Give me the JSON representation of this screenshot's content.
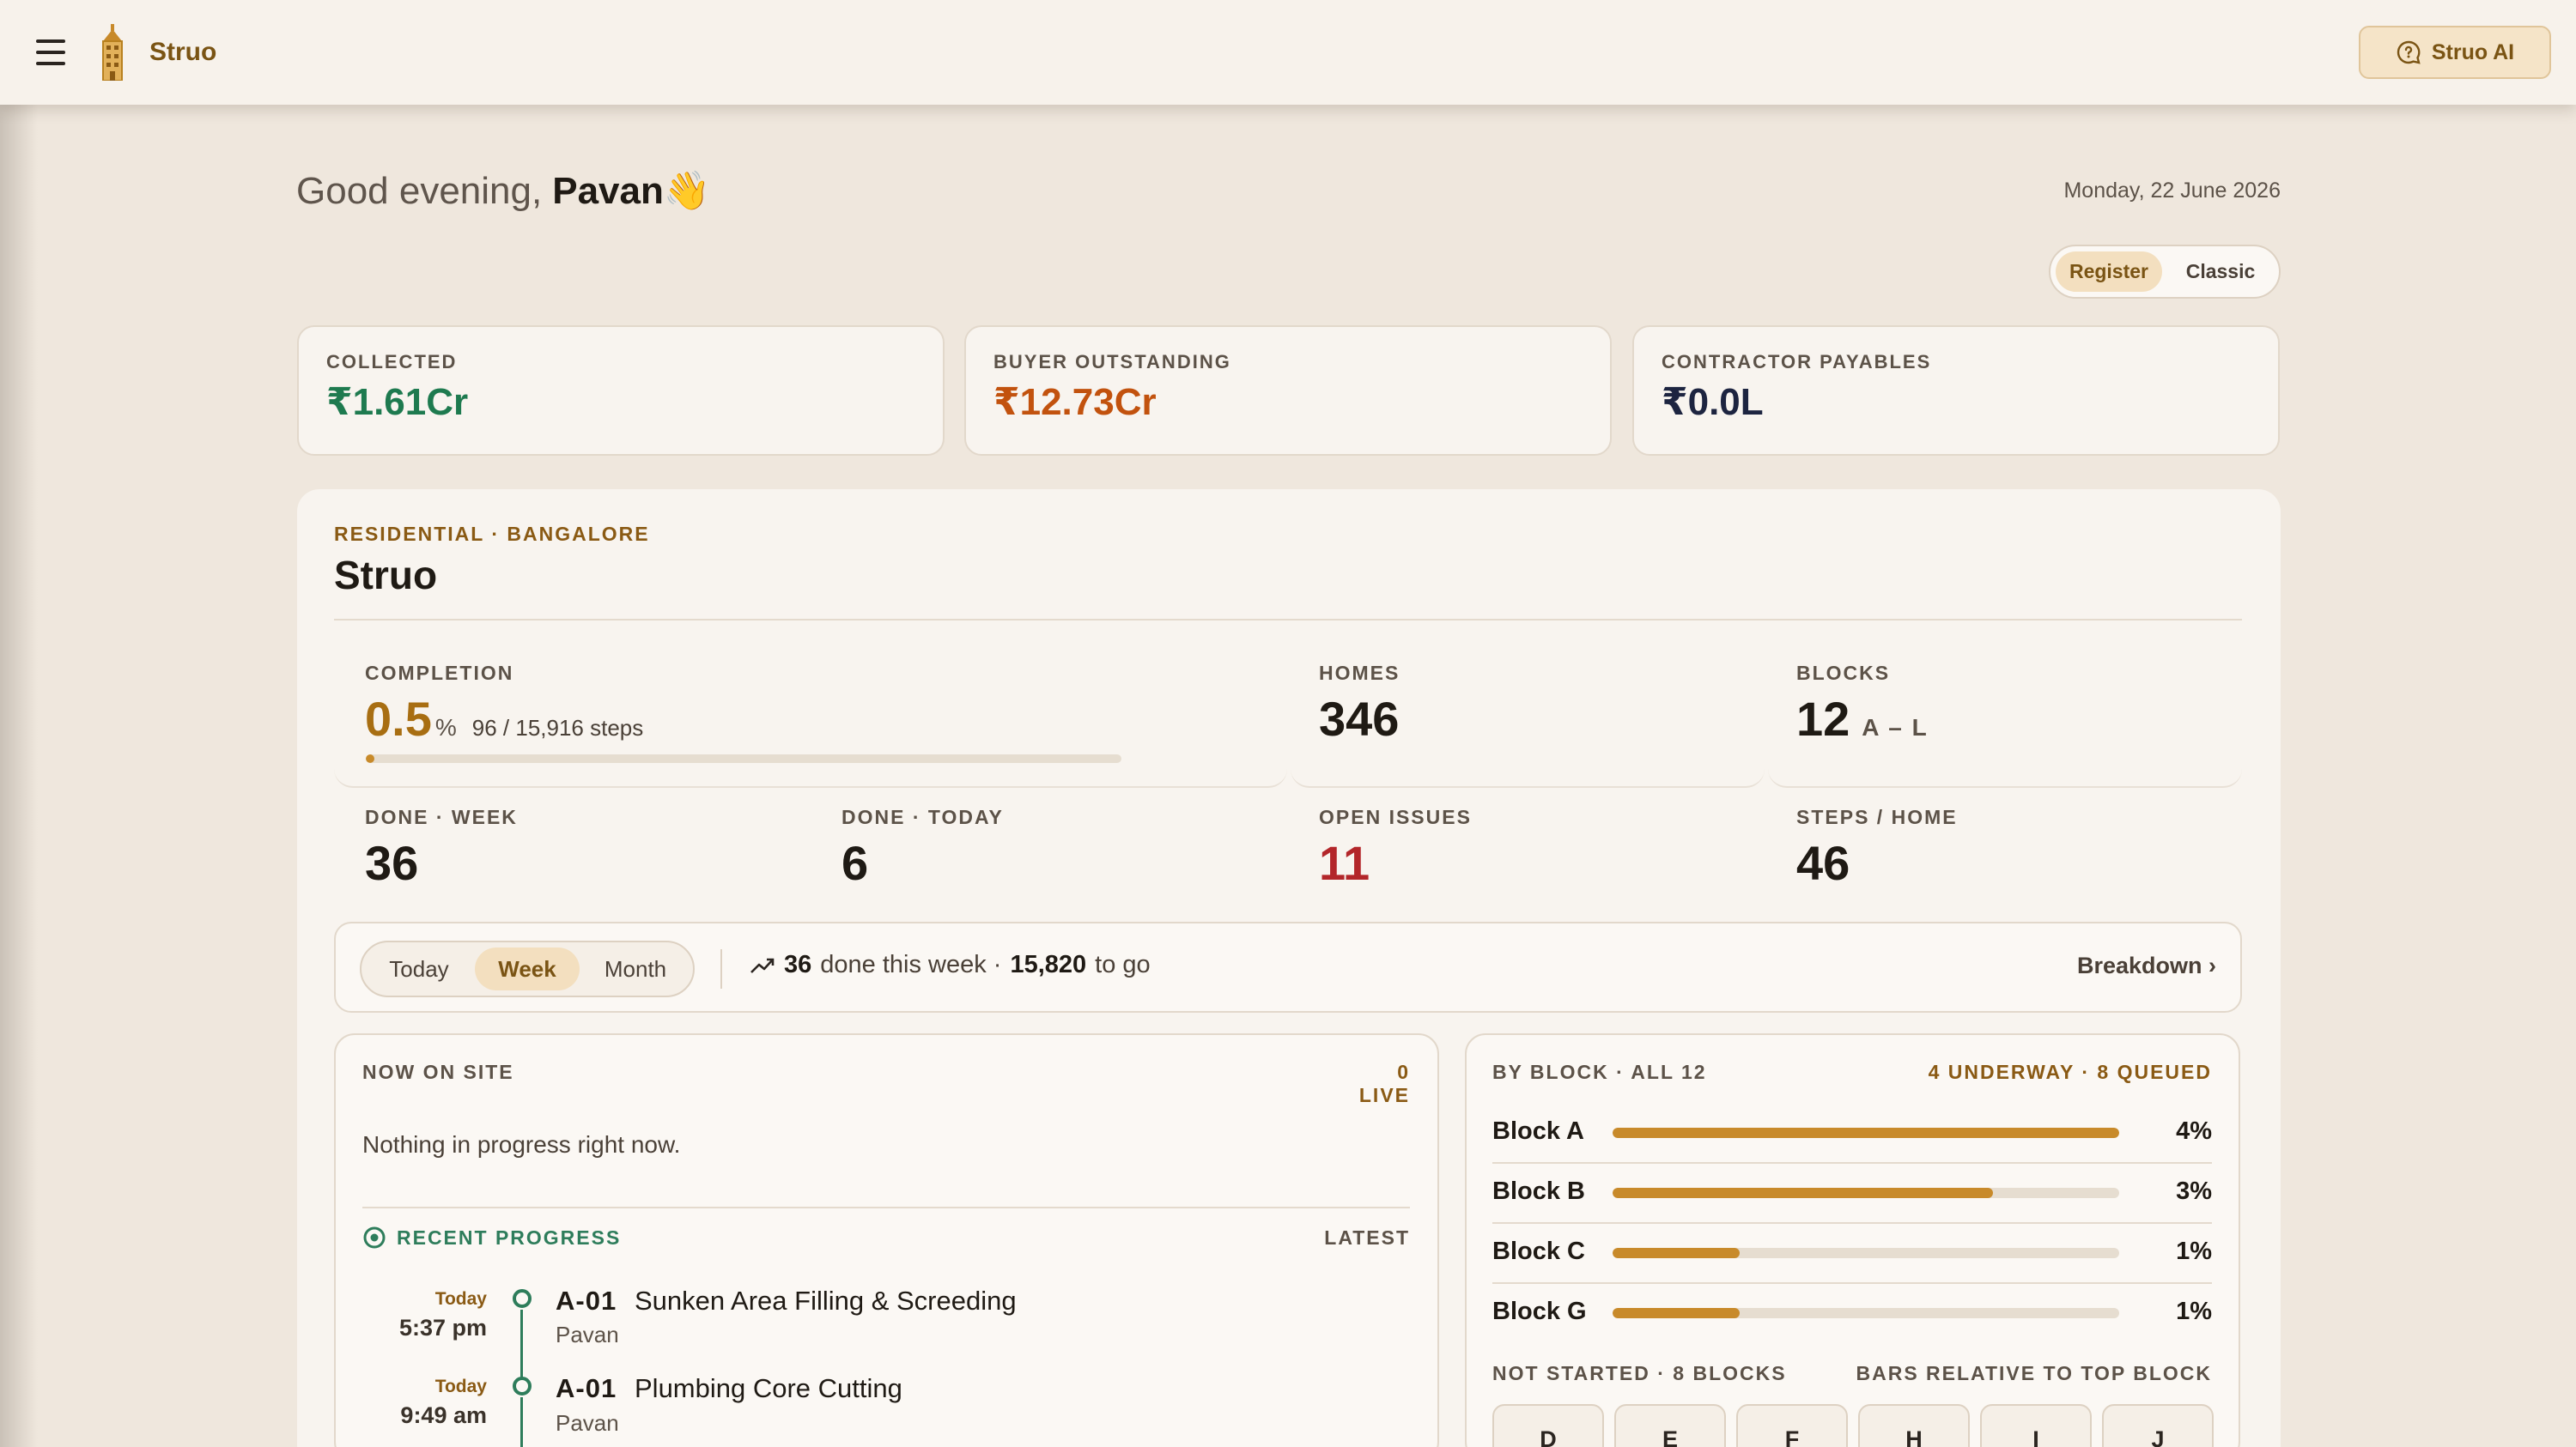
{
  "header": {
    "brand": "Struo",
    "ai_button": "Struo AI"
  },
  "greeting": {
    "prefix": "Good evening,",
    "name": "Pavan",
    "emoji": "👋",
    "date": "Monday, 22 June 2026"
  },
  "view_toggle": {
    "options": [
      "Register",
      "Classic"
    ],
    "selected": "Register"
  },
  "kpis": [
    {
      "label": "COLLECTED",
      "value": "₹1.61Cr",
      "color": "#1e7a4f"
    },
    {
      "label": "BUYER OUTSTANDING",
      "value": "₹12.73Cr",
      "color": "#c2520e"
    },
    {
      "label": "CONTRACTOR PAYABLES",
      "value": "₹0.0L",
      "color": "#1d2440"
    }
  ],
  "project": {
    "tag": "RESIDENTIAL · BANGALORE",
    "name": "Struo",
    "completion": {
      "label": "COMPLETION",
      "value": "0.5",
      "unit": "%",
      "steps": "96 / 15,916 steps",
      "progress": 0.005
    },
    "homes": {
      "label": "HOMES",
      "value": "346"
    },
    "blocks": {
      "label": "BLOCKS",
      "value": "12",
      "range": "A – L"
    },
    "done_week": {
      "label": "DONE · WEEK",
      "value": "36"
    },
    "done_today": {
      "label": "DONE · TODAY",
      "value": "6"
    },
    "open_issues": {
      "label": "OPEN ISSUES",
      "value": "11",
      "color": "#b3262a"
    },
    "steps_home": {
      "label": "STEPS / HOME",
      "value": "46"
    }
  },
  "range": {
    "options": [
      "Today",
      "Week",
      "Month"
    ],
    "selected": "Week",
    "done_count": "36",
    "done_text": "done this week ·",
    "to_go_count": "15,820",
    "to_go_text": "to go",
    "breakdown": "Breakdown ›"
  },
  "now_on_site": {
    "title": "NOW ON SITE",
    "live": "0 LIVE",
    "empty": "Nothing in progress right now.",
    "recent_title": "RECENT PROGRESS",
    "recent_sort": "LATEST",
    "items": [
      {
        "day": "Today",
        "time": "5:37 pm",
        "code": "A-01",
        "title": "Sunken Area Filling & Screeding",
        "who": "Pavan"
      },
      {
        "day": "Today",
        "time": "9:49 am",
        "code": "A-01",
        "title": "Plumbing Core Cutting",
        "who": "Pavan"
      }
    ]
  },
  "by_block": {
    "title": "BY BLOCK · ALL 12",
    "status": "4 UNDERWAY · 8 QUEUED",
    "blocks": [
      {
        "name": "Block A",
        "pct": "4%",
        "relative": 1.0
      },
      {
        "name": "Block B",
        "pct": "3%",
        "relative": 0.75
      },
      {
        "name": "Block C",
        "pct": "1%",
        "relative": 0.25
      },
      {
        "name": "Block G",
        "pct": "1%",
        "relative": 0.25
      }
    ],
    "not_started_label": "NOT STARTED · 8 BLOCKS",
    "relative_note": "BARS RELATIVE TO TOP BLOCK",
    "not_started": [
      "D",
      "E",
      "F",
      "H",
      "I",
      "J"
    ]
  }
}
